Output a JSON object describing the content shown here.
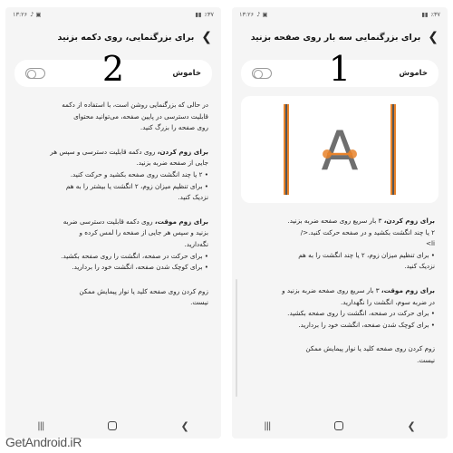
{
  "panels": {
    "left": {
      "status": {
        "time": "۱۳:۲۶",
        "battery": "٪۳۷"
      },
      "header_title": "برای بزرگنمایی، روی دکمه بزنید",
      "toggle_label": "خاموش",
      "marker": "2",
      "paragraphs": [
        {
          "lines": [
            "در حالی که بزرگنمایی روشن است، با استفاده از دکمه",
            "قابلیت دسترسی در پایین صفحه، می‌توانید محتوای",
            "روی صفحه را بزرگ کنید."
          ]
        },
        {
          "bold": "برای زوم کردن،",
          "lines": [
            " روی دکمه قابلیت دسترسی و سپس هر",
            "جایی از صفحه ضربه بزنید.",
            "• ۲ یا چند انگشت روی صفحه بکشید و حرکت کنید.",
            "• برای تنظیم میزان زوم، ۲ انگشت یا بیشتر را به هم",
            "   نزدیک کنید."
          ]
        },
        {
          "bold": "برای زوم موقت،",
          "lines": [
            " روی دکمه قابلیت دسترسی ضربه",
            "بزنید و سپس هر جایی از صفحه را لمس کرده و",
            "   نگه‌دارید.",
            "• برای حرکت در صفحه، انگشت را روی صفحه بکشید.",
            "• برای کوچک شدن صفحه، انگشت خود را بردارید."
          ]
        },
        {
          "lines": [
            "زوم کردن روی صفحه کلید یا نوار پیمایش ممکن",
            "نیست."
          ]
        }
      ]
    },
    "right": {
      "status": {
        "time": "۱۳:۲۶",
        "battery": "٪۳۷"
      },
      "header_title": "برای بزرگنمایی سه بار روی صفحه بزنید",
      "toggle_label": "خاموش",
      "marker": "1",
      "preview_letter": "A",
      "paragraphs": [
        {
          "bold": "برای زوم کردن،",
          "lines": [
            " ۳ بار سریع روی صفحه ضربه بزنید.",
            "۲ یا چند انگشت بکشید و در صفحه حرکت کنید.</",
            "li>",
            "• برای تنظیم میزان زوم، ۲ یا چند انگشت را به هم",
            "   نزدیک کنید."
          ]
        },
        {
          "bold": "برای زوم موقت،",
          "lines": [
            " ۳ بار سریع روی صفحه ضربه بزنید و",
            "در ضربه سوم، انگشت را نگهدارید.",
            "• برای حرکت در صفحه، انگشت را روی صفحه بکشید.",
            "• برای کوچک شدن صفحه، انگشت خود را بردارید."
          ]
        },
        {
          "lines": [
            "زوم کردن روی صفحه کلید یا نوار پیمایش ممکن",
            "نیست."
          ]
        }
      ]
    }
  },
  "watermark": "GetAndroid.iR",
  "colors": {
    "accent_orange": "#e8832a",
    "panel_bg": "#f5f5f5"
  }
}
